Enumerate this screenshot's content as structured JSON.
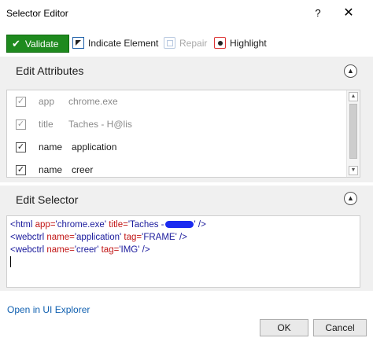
{
  "window": {
    "title": "Selector Editor",
    "help_label": "?",
    "close_label": "✕"
  },
  "toolbar": {
    "validate_label": "Validate",
    "validate_icon": "checkmark-icon",
    "indicate_label": "Indicate Element",
    "repair_label": "Repair",
    "highlight_label": "Highlight",
    "validate_color": "#1e8a1e"
  },
  "attributes": {
    "header": "Edit Attributes",
    "collapse_glyph": "▲",
    "rows": [
      {
        "checked": true,
        "dim": true,
        "name": "app",
        "value": "chrome.exe"
      },
      {
        "checked": true,
        "dim": true,
        "name": "title",
        "value": "Taches - H@lis"
      },
      {
        "checked": true,
        "dim": false,
        "name": "name",
        "value": "application"
      },
      {
        "checked": true,
        "dim": false,
        "name": "name",
        "value": "creer"
      }
    ],
    "scroll_up": "▲",
    "scroll_down": "▼"
  },
  "selector": {
    "header": "Edit Selector",
    "collapse_glyph": "▲",
    "line1": {
      "open": "<html ",
      "attr1": "app=",
      "val1": "'chrome.exe'",
      "attr2": " title=",
      "val2_start": "'Taches -",
      "val2_end": "'",
      "close": " />"
    },
    "line2": {
      "open": "<webctrl ",
      "attr1": "name=",
      "val1": "'application'",
      "attr2": " tag=",
      "val2": "'FRAME'",
      "close": " />"
    },
    "line3": {
      "open": "<webctrl ",
      "attr1": "name=",
      "val1": "'creer'",
      "attr2": " tag=",
      "val2": "'IMG'",
      "close": " />"
    }
  },
  "footer": {
    "explorer_link": "Open in UI Explorer",
    "ok_label": "OK",
    "cancel_label": "Cancel"
  }
}
